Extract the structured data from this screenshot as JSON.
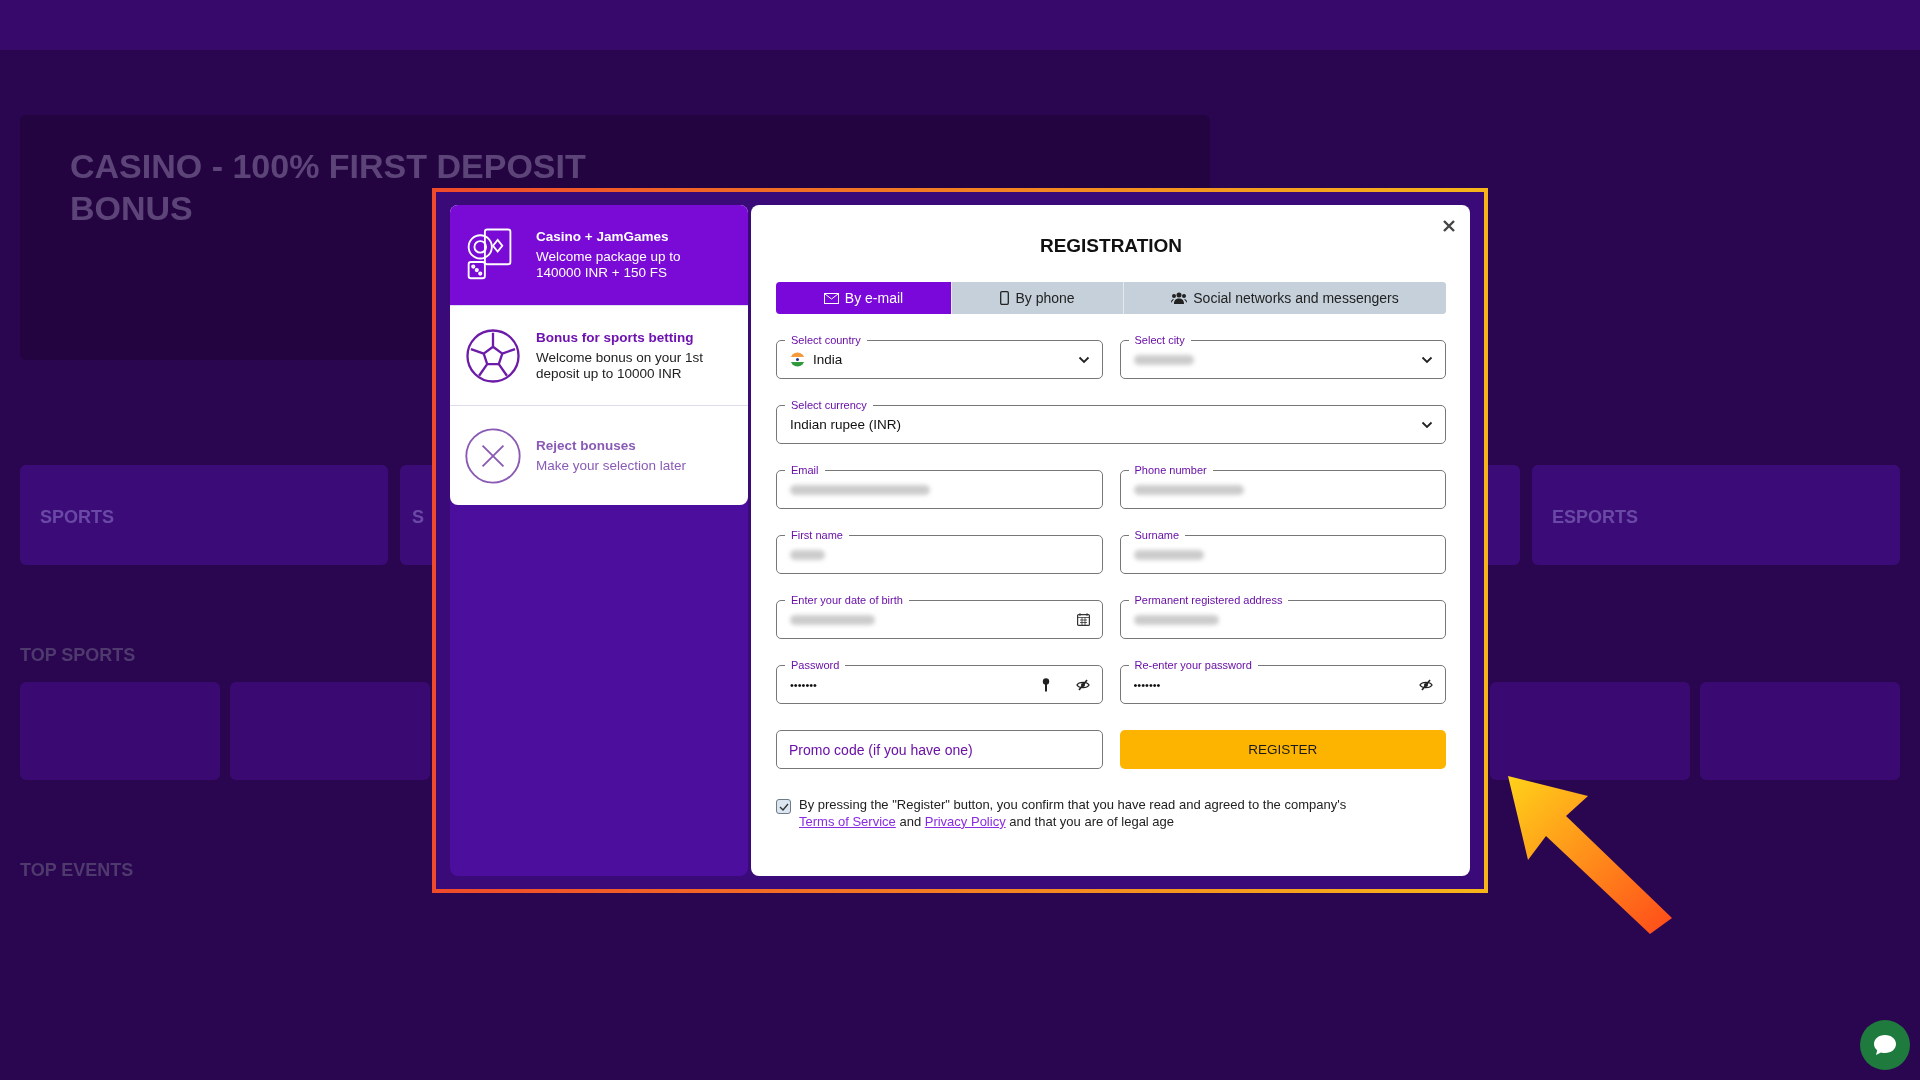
{
  "background": {
    "banner_title_lines": [
      "CASINO - 100% FIRST DEPOSIT",
      "BONUS"
    ],
    "categories": [
      "SPORTS",
      "S",
      "ESPORTS"
    ],
    "sections": [
      "TOP SPORTS",
      "TOP EVENTS"
    ]
  },
  "bonuses": [
    {
      "kind": "casino",
      "title": "Casino + JamGames",
      "text": "Welcome package up to 140000 INR + 150 FS",
      "selected": true
    },
    {
      "kind": "sports",
      "title": "Bonus for sports betting",
      "text": "Welcome bonus on your 1st deposit up to 10000 INR",
      "selected": false
    },
    {
      "kind": "reject",
      "title": "Reject bonuses",
      "text": "Make your selection later",
      "selected": false
    }
  ],
  "dialog": {
    "title": "REGISTRATION",
    "tabs": [
      {
        "kind": "email",
        "label": "By e-mail",
        "selected": true
      },
      {
        "kind": "phone",
        "label": "By phone",
        "selected": false
      },
      {
        "kind": "social",
        "label": "Social networks and messengers",
        "selected": false
      }
    ],
    "fields": [
      {
        "label": "Select country",
        "kind": "select",
        "flag": true,
        "value": "India",
        "blurred": false,
        "wide": false
      },
      {
        "label": "Select city",
        "kind": "select",
        "blurred": true,
        "wide": false
      },
      {
        "label": "Select currency",
        "kind": "select",
        "value": "Indian rupee (INR)",
        "blurred": false,
        "wide": true
      },
      {
        "label": "Email",
        "kind": "input",
        "blurred": true,
        "wide": false
      },
      {
        "label": "Phone number",
        "kind": "input",
        "blurred": true,
        "wide": false
      },
      {
        "label": "First name",
        "kind": "input",
        "blurred": true,
        "wide": false
      },
      {
        "label": "Surname",
        "kind": "input",
        "blurred": true,
        "wide": false
      },
      {
        "label": "Enter your date of birth",
        "kind": "date",
        "blurred": true,
        "wide": false
      },
      {
        "label": "Permanent registered address",
        "kind": "input",
        "blurred": true,
        "wide": false
      },
      {
        "label": "Password",
        "kind": "password",
        "key": true,
        "value": "•••••••",
        "blurred": false,
        "wide": false
      },
      {
        "label": "Re-enter your password",
        "kind": "password",
        "value": "•••••••",
        "blurred": false,
        "wide": false
      }
    ],
    "promo": {
      "placeholder": "Promo code (if you have one)"
    },
    "submit": "REGISTER",
    "consent": {
      "checked": true,
      "parts": [
        {
          "kind": "text",
          "text": "By pressing the \"Register\" button, you confirm that you have read and agreed to the company's "
        },
        {
          "kind": "link",
          "text": "Terms of Service"
        },
        {
          "kind": "text",
          "text": " and "
        },
        {
          "kind": "link",
          "text": "Privacy Policy"
        },
        {
          "kind": "text",
          "text": " and that you are of legal age"
        }
      ]
    }
  }
}
